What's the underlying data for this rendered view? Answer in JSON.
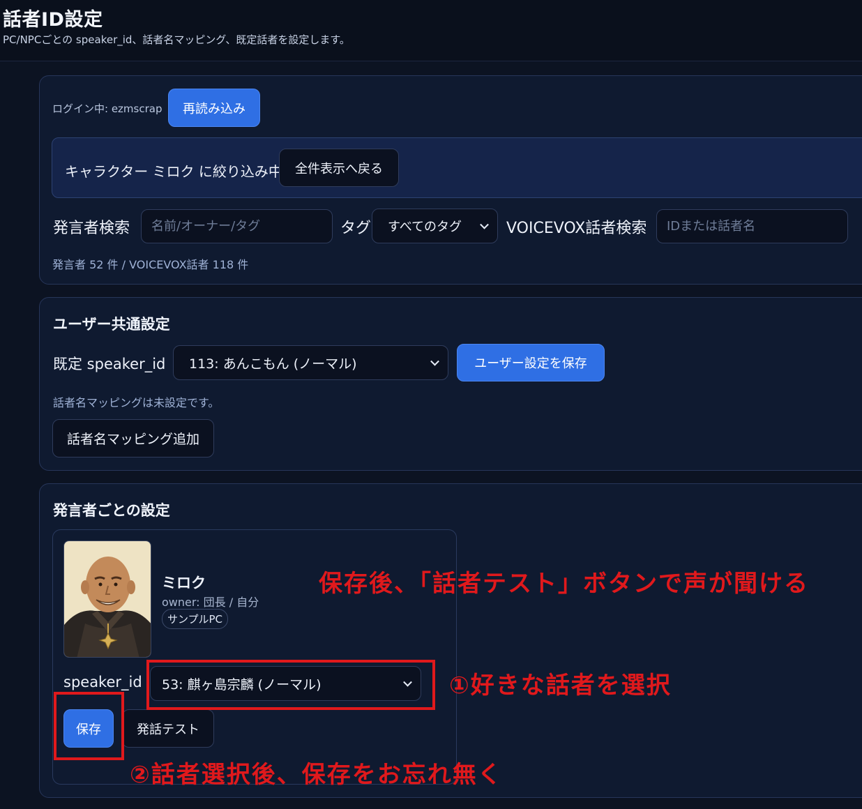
{
  "header": {
    "title": "話者ID設定",
    "subtitle": "PC/NPCごとの speaker_id、話者名マッピング、既定話者を設定します。"
  },
  "top_panel": {
    "login_status": "ログイン中: ezmscrap",
    "reload_label": "再読み込み",
    "filter_notice": "キャラクター ミロク に絞り込み中",
    "show_all_label": "全件表示へ戻る",
    "speaker_search_label": "発言者検索",
    "speaker_search_placeholder": "名前/オーナー/タグ",
    "tag_label": "タグ",
    "tag_selected": "すべてのタグ",
    "voicevox_search_label": "VOICEVOX話者検索",
    "voicevox_search_placeholder": "IDまたは話者名",
    "counts": "発言者 52 件 / VOICEVOX話者 118 件"
  },
  "user_settings": {
    "title": "ユーザー共通設定",
    "default_speaker_label": "既定 speaker_id",
    "default_speaker_selected": "113: あんこもん (ノーマル)",
    "save_label": "ユーザー設定を保存",
    "mapping_empty": "話者名マッピングは未設定です。",
    "add_mapping_label": "話者名マッピング追加"
  },
  "per_speaker": {
    "title": "発言者ごとの設定",
    "card": {
      "name": "ミロク",
      "owner": "owner: 団長 / 自分",
      "tag": "サンプルPC",
      "speaker_id_label": "speaker_id",
      "speaker_id_selected": "53: 麒ヶ島宗麟 (ノーマル)",
      "save_label": "保存",
      "test_label": "発話テスト"
    }
  },
  "annotations": {
    "note_top": "保存後、「話者テスト」ボタンで声が聞ける",
    "note_select": "①好きな話者を選択",
    "note_save": "②話者選択後、保存をお忘れ無く"
  },
  "colors": {
    "accent": "#2f6fe4",
    "background": "#0c1322",
    "panel": "#0f1a30",
    "annotation_red": "#e0191c"
  }
}
